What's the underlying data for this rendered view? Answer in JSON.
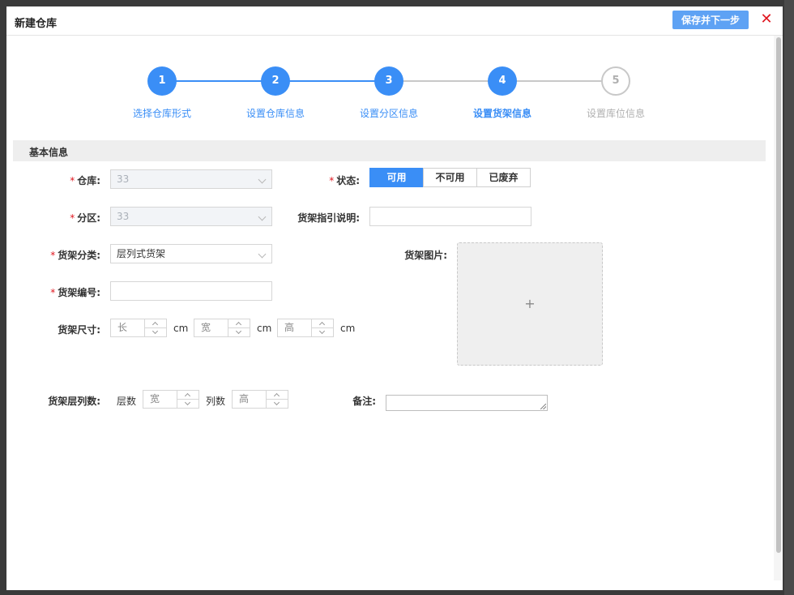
{
  "modal": {
    "title": "新建仓库",
    "save_button": "保存并下一步",
    "close_icon": "close-icon"
  },
  "steps": [
    {
      "num": "1",
      "label": "选择仓库形式",
      "state": "done"
    },
    {
      "num": "2",
      "label": "设置仓库信息",
      "state": "done"
    },
    {
      "num": "3",
      "label": "设置分区信息",
      "state": "done"
    },
    {
      "num": "4",
      "label": "设置货架信息",
      "state": "current"
    },
    {
      "num": "5",
      "label": "设置库位信息",
      "state": "todo"
    }
  ],
  "section": {
    "title": "基本信息"
  },
  "form": {
    "warehouse": {
      "label": "仓库:",
      "value": "33"
    },
    "zone": {
      "label": "分区:",
      "value": "33"
    },
    "shelf_type": {
      "label": "货架分类:",
      "value": "层列式货架"
    },
    "shelf_code": {
      "label": "货架编号:",
      "value": ""
    },
    "shelf_size": {
      "label": "货架尺寸:",
      "length_placeholder": "长",
      "width_placeholder": "宽",
      "height_placeholder": "高",
      "unit": "cm"
    },
    "shelf_rows_cols": {
      "label": "货架层列数:",
      "layers_label": "层数",
      "layers_placeholder": "宽",
      "cols_label": "列数",
      "cols_placeholder": "高"
    },
    "status": {
      "label": "状态:",
      "options": [
        "可用",
        "不可用",
        "已废弃"
      ],
      "selected": "可用"
    },
    "guide": {
      "label": "货架指引说明:",
      "value": ""
    },
    "image": {
      "label": "货架图片:",
      "plus": "+"
    },
    "remark": {
      "label": "备注:"
    }
  },
  "colors": {
    "primary": "#3a8ef6",
    "required": "#e0161f",
    "close": "#e0161f"
  }
}
